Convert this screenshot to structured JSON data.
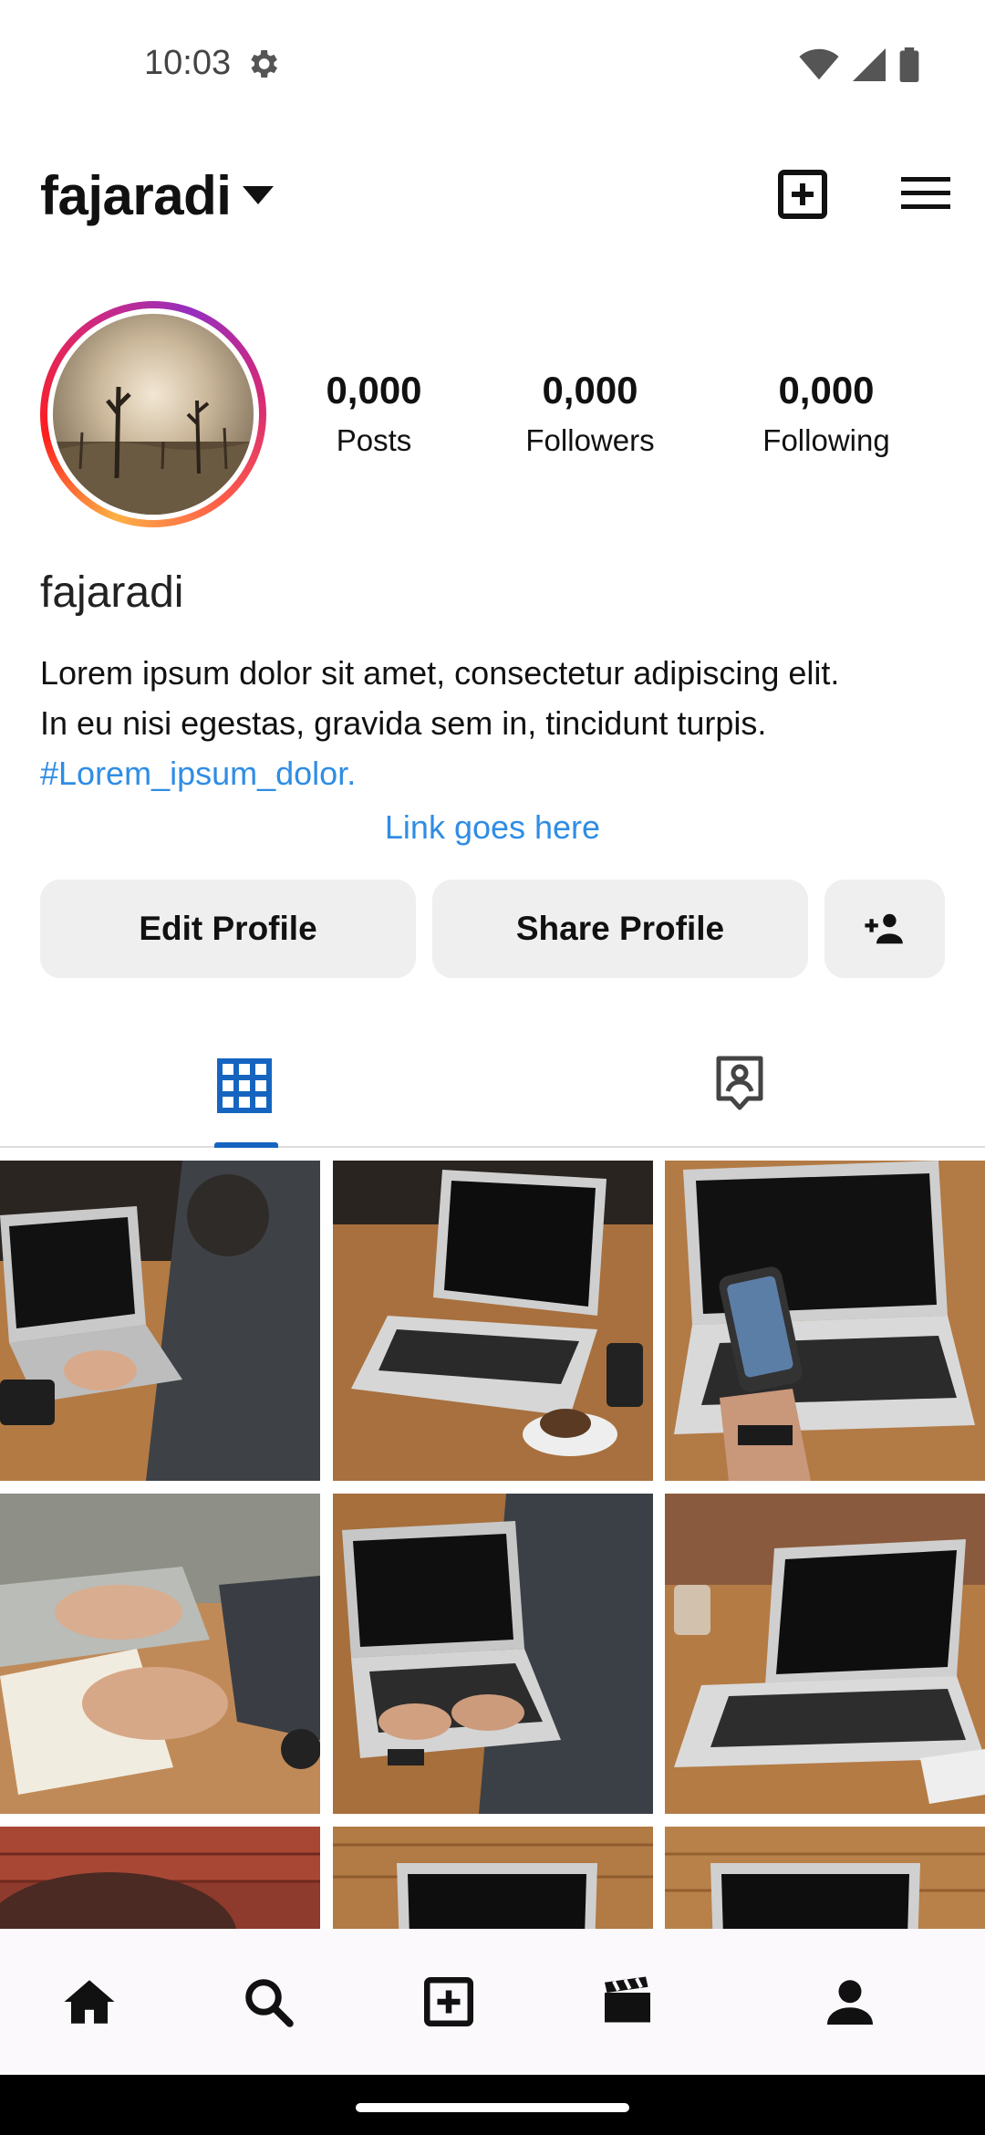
{
  "status_bar": {
    "time": "10:03"
  },
  "header": {
    "username": "fajaradi"
  },
  "profile": {
    "stats": [
      {
        "value": "0,000",
        "label": "Posts"
      },
      {
        "value": "0,000",
        "label": "Followers"
      },
      {
        "value": "0,000",
        "label": "Following"
      }
    ],
    "display_name": "fajaradi",
    "bio_line1": "Lorem ipsum dolor sit amet, consectetur adipiscing elit.",
    "bio_line2": "In eu nisi egestas, gravida sem in, tincidunt turpis.",
    "hashtag": "#Lorem_ipsum_dolor.",
    "link": "Link goes here"
  },
  "actions": {
    "edit_label": "Edit Profile",
    "share_label": "Share Profile"
  },
  "tabs": {
    "active": "grid",
    "accent_color": "#1565c0"
  },
  "colors": {
    "link": "#2f8de4",
    "button_bg": "#efefef",
    "nav_bg": "#fcf9fd"
  },
  "bottom_nav": [
    "home-icon",
    "search-icon",
    "add-post-icon",
    "reels-icon",
    "profile-icon"
  ]
}
